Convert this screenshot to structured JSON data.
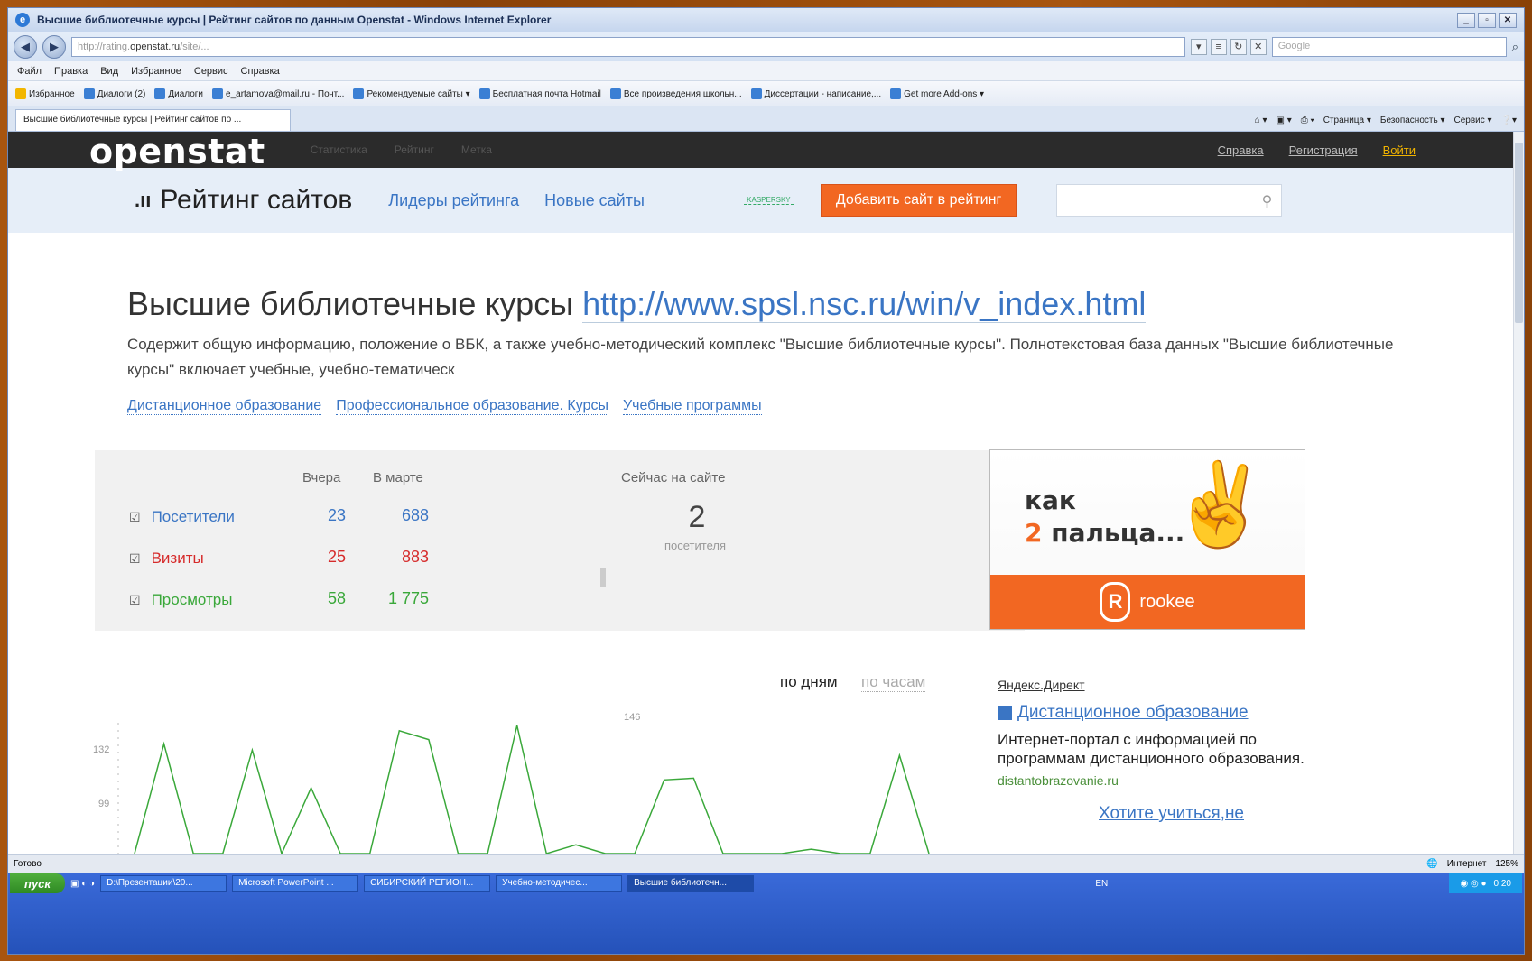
{
  "browser": {
    "window_title": "Высшие библиотечные курсы | Рейтинг сайтов по данным Openstat - Windows Internet Explorer",
    "url_prefix": "http://rating.",
    "url_domain": "openstat.ru",
    "url_suffix": "/site/...",
    "search_placeholder": "Google",
    "menu": [
      "Файл",
      "Правка",
      "Вид",
      "Избранное",
      "Сервис",
      "Справка"
    ],
    "favorites": [
      "Избранное",
      "Диалоги (2)",
      "Диалоги",
      "e_artamova@mail.ru - Почт...",
      "Рекомендуемые сайты ▾",
      "Бесплатная почта Hotmail",
      "Все произведения школьн...",
      "Диссертации - написание,...",
      "Get more Add-ons ▾"
    ],
    "tab_label": "Высшие библиотечные курсы | Рейтинг сайтов по ...",
    "tab_tools": [
      "Страница ▾",
      "Безопасность ▾",
      "Сервис ▾"
    ],
    "status_left": "Готово",
    "status_zone": "Интернет",
    "zoom": "125%"
  },
  "site": {
    "logo": "openstat",
    "nav": [
      "Статистика",
      "Рейтинг",
      "Метка"
    ],
    "right_links": [
      "Справка",
      "Регистрация",
      "Войти"
    ],
    "rating_title": "Рейтинг сайтов",
    "rating_links": [
      "Лидеры рейтинга",
      "Новые сайты"
    ],
    "kaspersky": "KASPERSKY",
    "add_button": "Добавить сайт в рейтинг"
  },
  "main": {
    "title": "Высшие библиотечные курсы",
    "title_url": "http://www.spsl.nsc.ru/win/v_index.html",
    "description": "Содержит общую информацию, положение о ВБК, а также учебно-методический комплекс \"Высшие библиотечные курсы\". Полнотекстовая база данных \"Высшие библиотечные курсы\" включает учебные, учебно-тематическ",
    "tags": [
      "Дистанционное образование",
      "Профессиональное образование. Курсы",
      "Учебные программы"
    ]
  },
  "stats": {
    "col_yesterday": "Вчера",
    "col_month": "В марте",
    "col_now": "Сейчас на сайте",
    "now_value": "2",
    "now_sub": "посетителя",
    "rows": [
      {
        "label": "Посетители",
        "yesterday": "23",
        "month": "688",
        "color": "#3a75c4"
      },
      {
        "label": "Визиты",
        "yesterday": "25",
        "month": "883",
        "color": "#d62b2b"
      },
      {
        "label": "Просмотры",
        "yesterday": "58",
        "month": "1 775",
        "color": "#3aa83a"
      }
    ]
  },
  "ad": {
    "line1": "как",
    "line2_num": "2",
    "line2_text": "пальца...",
    "brand": "rookee"
  },
  "period": {
    "days": "по дням",
    "hours": "по часам"
  },
  "chart_data": {
    "type": "line",
    "color": "#3aa83a",
    "y_ticks": [
      "132",
      "99"
    ],
    "peak_label": "146",
    "values": [
      0,
      125,
      0,
      0,
      118,
      0,
      75,
      0,
      0,
      140,
      130,
      0,
      0,
      146,
      0,
      10,
      0,
      0,
      84,
      86,
      0,
      0,
      0,
      5,
      0,
      0,
      112,
      0
    ]
  },
  "direct": {
    "label": "Яндекс.Директ",
    "title": "Дистанционное образование",
    "body": "Интернет-портал с информацией по программам дистанционного образования.",
    "url": "distantobrazovanie.ru",
    "title2": "Хотите учиться,не"
  },
  "taskbar": {
    "start": "пуск",
    "items": [
      "D:\\Презентации\\20...",
      "Microsoft PowerPoint ...",
      "СИБИРСКИЙ РЕГИОН...",
      "Учебно-методичес...",
      "Высшие библиотечн..."
    ],
    "lang": "EN",
    "clock": "0:20"
  }
}
